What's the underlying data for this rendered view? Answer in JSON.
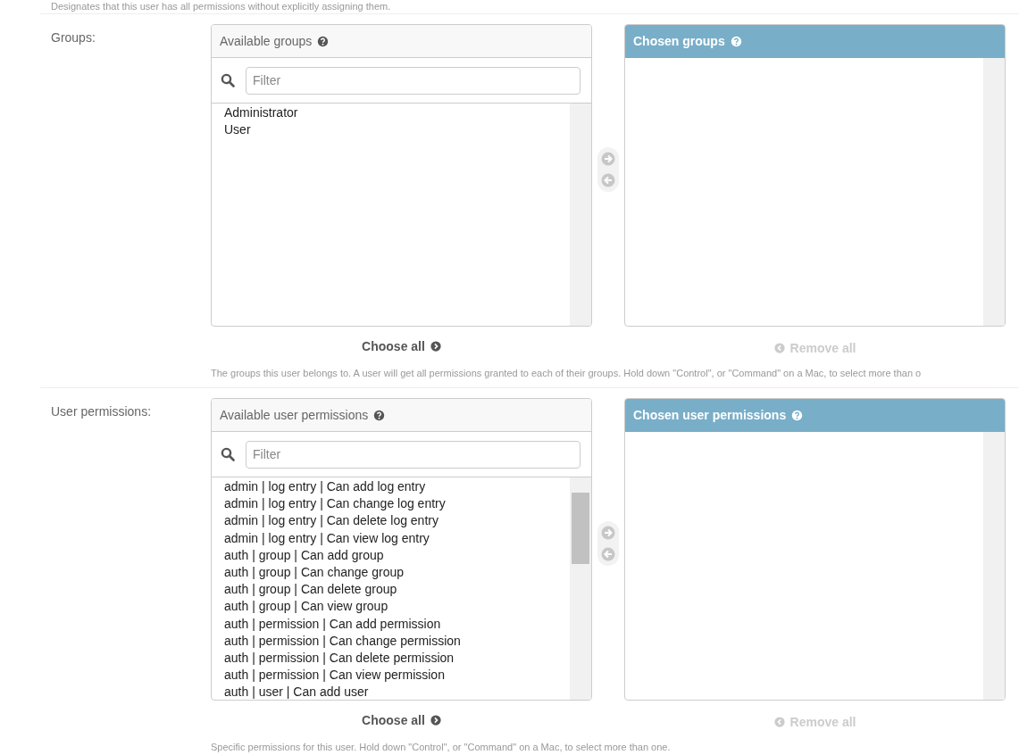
{
  "top_help": "Designates that this user has all permissions without explicitly assigning them.",
  "fields": [
    {
      "label": "Groups:",
      "available": {
        "title": "Available groups",
        "filter_placeholder": "Filter",
        "items": [
          "Administrator",
          "User"
        ]
      },
      "chosen": {
        "title": "Chosen groups"
      },
      "add_disabled": true,
      "remove_disabled": true,
      "choose_all": {
        "label": "Choose all",
        "disabled": false
      },
      "remove_all": {
        "label": "Remove all",
        "disabled": true
      },
      "help": "The groups this user belongs to. A user will get all permissions granted to each of their groups. Hold down \"Control\", or \"Command\" on a Mac, to select more than o"
    },
    {
      "label": "User permissions:",
      "available": {
        "title": "Available user permissions",
        "filter_placeholder": "Filter",
        "items": [
          "admin | log entry | Can add log entry",
          "admin | log entry | Can change log entry",
          "admin | log entry | Can delete log entry",
          "admin | log entry | Can view log entry",
          "auth | group | Can add group",
          "auth | group | Can change group",
          "auth | group | Can delete group",
          "auth | group | Can view group",
          "auth | permission | Can add permission",
          "auth | permission | Can change permission",
          "auth | permission | Can delete permission",
          "auth | permission | Can view permission",
          "auth | user | Can add user"
        ]
      },
      "chosen": {
        "title": "Chosen user permissions"
      },
      "add_disabled": true,
      "remove_disabled": true,
      "choose_all": {
        "label": "Choose all",
        "disabled": false
      },
      "remove_all": {
        "label": "Remove all",
        "disabled": true
      },
      "help": "Specific permissions for this user. Hold down \"Control\", or \"Command\" on a Mac, to select more than one."
    }
  ]
}
